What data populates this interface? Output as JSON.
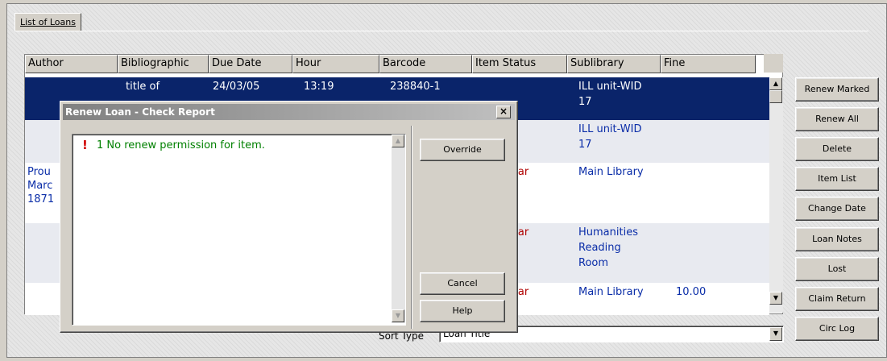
{
  "tab": {
    "label": "List of Loans"
  },
  "table": {
    "headers": [
      "Author",
      "Bibliographic",
      "Due Date",
      "Hour",
      "Barcode",
      "Item Status",
      "Sublibrary",
      "Fine"
    ],
    "rows": [
      {
        "selected": true,
        "author": "",
        "title": "title of",
        "due": "24/03/05",
        "hour": "13:19",
        "barcode": "238840-1",
        "status": "",
        "sublib1": "ILL unit-WID",
        "sublib2": "17",
        "sublib3": "",
        "fine": ""
      },
      {
        "selected": false,
        "author": "",
        "title": "",
        "due": "",
        "hour": "",
        "barcode": "",
        "status": "",
        "sublib1": "ILL unit-WID",
        "sublib2": "17",
        "sublib3": "",
        "fine": ""
      },
      {
        "selected": false,
        "author": "Prou",
        "author2": "Marc",
        "author3": "1871",
        "title": "",
        "due": "",
        "hour": "",
        "barcode": "",
        "status": "ular",
        "sublib1": "Main Library",
        "sublib2": "",
        "sublib3": "",
        "fine": ""
      },
      {
        "selected": false,
        "author": "",
        "title": "",
        "due": "",
        "hour": "",
        "barcode": "",
        "status": "ular",
        "sublib1": "Humanities",
        "sublib2": "Reading",
        "sublib3": "Room",
        "fine": ""
      },
      {
        "selected": false,
        "author": "",
        "title": "",
        "due": "",
        "hour": "",
        "barcode": "",
        "status": "ular",
        "sublib1": "Main Library",
        "sublib2": "",
        "sublib3": "",
        "fine": "10.00"
      }
    ]
  },
  "sort": {
    "label": "Sort Type",
    "value": "Loan Title"
  },
  "side_buttons": [
    {
      "id": "renew-marked",
      "label": "Renew Marked"
    },
    {
      "id": "renew-all",
      "label": "Renew All"
    },
    {
      "id": "delete",
      "label": "Delete"
    },
    {
      "id": "item-list",
      "label": "Item List"
    },
    {
      "id": "change-date",
      "label": "Change Date"
    },
    {
      "id": "loan-notes",
      "label": "Loan Notes"
    },
    {
      "id": "lost",
      "label": "Lost"
    },
    {
      "id": "claim-return",
      "label": "Claim Return"
    },
    {
      "id": "circ-log",
      "label": "Circ Log"
    }
  ],
  "dialog": {
    "title": "Renew Loan - Check Report",
    "close": "×",
    "message_icon": "!",
    "message": "1 No renew permission for item.",
    "override": "Override",
    "cancel": "Cancel",
    "help": "Help"
  },
  "colors": {
    "selection": "#0a246a",
    "link_text": "#0a2da8",
    "status_text": "#b00000",
    "message_text": "#008000",
    "alt_row": "#e8eaf0"
  },
  "icons": {
    "scroll_up": "▲",
    "scroll_down": "▼",
    "combo_arrow": "▼"
  }
}
